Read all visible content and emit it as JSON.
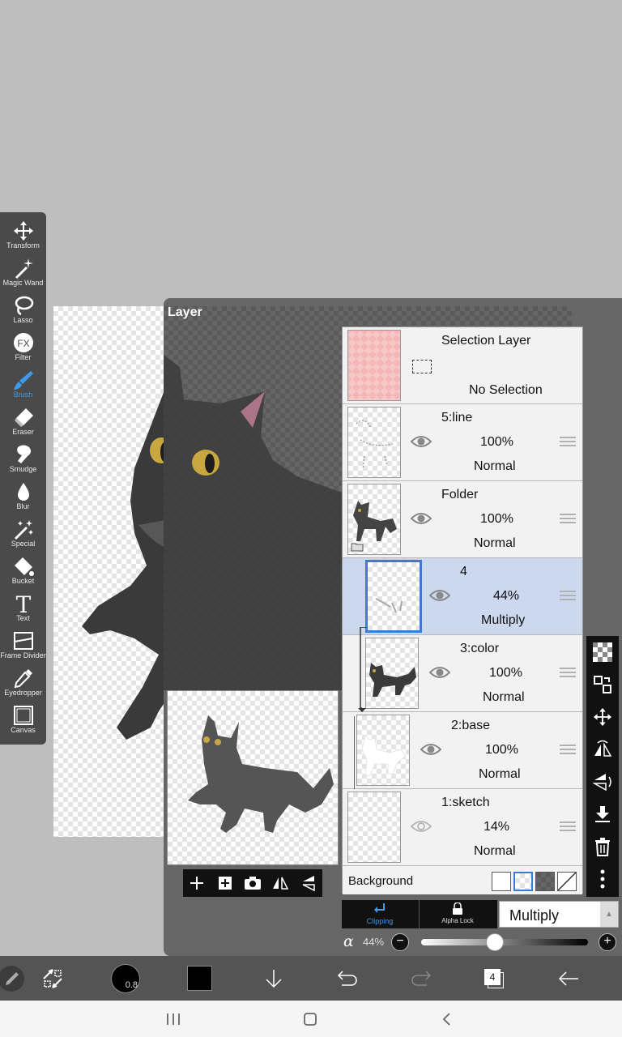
{
  "toolbar": {
    "tools": [
      {
        "label": "Transform",
        "icon": "move-icon"
      },
      {
        "label": "Magic Wand",
        "icon": "magic-wand-icon"
      },
      {
        "label": "Lasso",
        "icon": "lasso-icon"
      },
      {
        "label": "Filter",
        "icon": "fx-icon"
      },
      {
        "label": "Brush",
        "icon": "brush-icon",
        "active": true
      },
      {
        "label": "Eraser",
        "icon": "eraser-icon"
      },
      {
        "label": "Smudge",
        "icon": "smudge-icon"
      },
      {
        "label": "Blur",
        "icon": "blur-drop-icon"
      },
      {
        "label": "Special",
        "icon": "special-icon"
      },
      {
        "label": "Bucket",
        "icon": "bucket-icon"
      },
      {
        "label": "Text",
        "icon": "text-icon"
      },
      {
        "label": "Frame Divider",
        "icon": "frame-divider-icon"
      },
      {
        "label": "Eyedropper",
        "icon": "eyedropper-icon"
      },
      {
        "label": "Canvas",
        "icon": "canvas-icon"
      }
    ],
    "filter_glyph": "FX",
    "text_glyph": "T"
  },
  "layer_panel": {
    "title": "Layer",
    "selection_layer": {
      "name": "Selection Layer",
      "status": "No Selection"
    },
    "layers": [
      {
        "name": "5:line",
        "opacity": "100%",
        "blend": "Normal",
        "visible": true
      },
      {
        "name": "Folder",
        "opacity": "100%",
        "blend": "Normal",
        "visible": true
      },
      {
        "name": "4",
        "opacity": "44%",
        "blend": "Multiply",
        "visible": true,
        "selected": true
      },
      {
        "name": "3:color",
        "opacity": "100%",
        "blend": "Normal",
        "visible": true
      },
      {
        "name": "2:base",
        "opacity": "100%",
        "blend": "Normal",
        "visible": true
      },
      {
        "name": "1:sketch",
        "opacity": "14%",
        "blend": "Normal",
        "visible": false
      }
    ],
    "background_label": "Background",
    "clipping_label": "Clipping",
    "alpha_lock_label": "Alpha Lock",
    "blend_mode": "Multiply",
    "alpha_symbol": "α",
    "opacity_value": "44%",
    "opacity_fraction": 0.44,
    "minus": "−",
    "plus": "+"
  },
  "bottom_bar": {
    "brush_size": "0.8",
    "layer_count": "4",
    "color": "#000000"
  },
  "colors": {
    "accent": "#3d9be9",
    "selected_row": "#cbd8ee",
    "panel": "#666666",
    "toolbar": "#4a4a4a"
  }
}
